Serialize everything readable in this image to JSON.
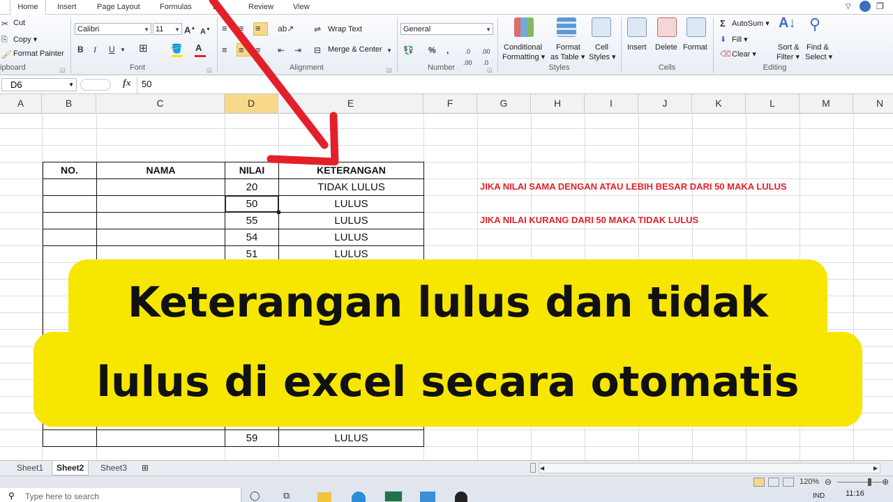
{
  "ribbon": {
    "tabs": [
      "Home",
      "Insert",
      "Page Layout",
      "Formulas",
      "D",
      "Review",
      "View"
    ],
    "clipboard": {
      "cut": "Cut",
      "copy": "Copy ▾",
      "format_painter": "Format Painter",
      "label": "ipboard"
    },
    "font": {
      "name": "Calibri",
      "size": "11",
      "label": "Font"
    },
    "alignment": {
      "wrap": "Wrap Text",
      "merge": "Merge & Center",
      "label": "Alignment"
    },
    "number": {
      "format": "General",
      "label": "Number",
      "percent": "%",
      "comma": ","
    },
    "styles": {
      "conditional": "Conditional",
      "formatting": "Formatting ▾",
      "format_as": "Format",
      "as_table": "as Table ▾",
      "cell": "Cell",
      "cell_styles": "Styles ▾",
      "label": "Styles"
    },
    "cells": {
      "insert": "Insert",
      "delete": "Delete",
      "format": "Format",
      "label": "Cells"
    },
    "editing": {
      "autosum": "AutoSum ▾",
      "fill": "Fill ▾",
      "clear": "Clear ▾",
      "sort": "Sort &",
      "filter": "Filter ▾",
      "find": "Find &",
      "select": "Select ▾",
      "label": "Editing"
    }
  },
  "formula_bar": {
    "name_box": "D6",
    "fx": "fx",
    "value": "50"
  },
  "columns": [
    "A",
    "B",
    "C",
    "D",
    "E",
    "F",
    "G",
    "H",
    "I",
    "J",
    "K",
    "L",
    "M",
    "N"
  ],
  "table": {
    "headers": {
      "no": "NO.",
      "nama": "NAMA",
      "nilai": "NILAI",
      "keterangan": "KETERANGAN"
    },
    "rows": [
      {
        "nilai": "20",
        "ket": "TIDAK LULUS"
      },
      {
        "nilai": "50",
        "ket": "LULUS"
      },
      {
        "nilai": "55",
        "ket": "LULUS"
      },
      {
        "nilai": "54",
        "ket": "LULUS"
      },
      {
        "nilai": "51",
        "ket": "LULUS"
      }
    ],
    "last_row": {
      "nilai": "59",
      "ket": "LULUS"
    }
  },
  "notes": {
    "rule1": "JIKA NILAI SAMA DENGAN ATAU LEBIH BESAR DARI 50 MAKA LULUS",
    "rule2": "JIKA NILAI KURANG DARI 50 MAKA TIDAK LULUS"
  },
  "banner": {
    "line1": "Keterangan lulus dan tidak",
    "line2": "lulus di excel secara otomatis"
  },
  "sheets": [
    "Sheet1",
    "Sheet2",
    "Sheet3"
  ],
  "status": {
    "zoom": "120%"
  },
  "taskbar": {
    "search": "Type here to search",
    "lang": "IND",
    "time": "11:16"
  },
  "colors": {
    "arrow": "#e3202a",
    "banner": "#f7e600",
    "selected_header": "#f8d98a"
  }
}
